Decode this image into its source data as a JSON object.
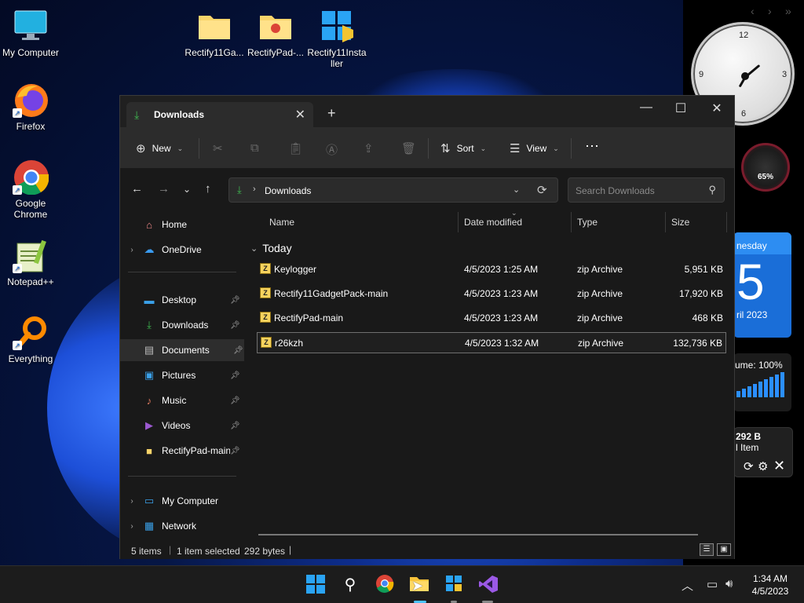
{
  "desktop": {
    "icons": [
      {
        "label": "My Computer"
      },
      {
        "label": "Firefox"
      },
      {
        "label": "Google Chrome"
      },
      {
        "label": "Notepad++"
      },
      {
        "label": "Everything"
      },
      {
        "label": "Rectify11Ga..."
      },
      {
        "label": "RectifyPad-..."
      },
      {
        "label": "Rectify11Insta ller"
      }
    ]
  },
  "widgets": {
    "clock_numbers": [
      "12",
      "3",
      "6",
      "9"
    ],
    "gauge_value": "65%",
    "calendar": {
      "day": "nesday",
      "date": "5",
      "month": "ril 2023"
    },
    "volume": {
      "label": "ume: 100%"
    },
    "recycle": {
      "size": "292 B",
      "items": "l Item"
    }
  },
  "explorer": {
    "tab": {
      "title": "Downloads"
    },
    "toolbar": {
      "new_label": "New",
      "sort_label": "Sort",
      "view_label": "View"
    },
    "address": {
      "location": "Downloads"
    },
    "search": {
      "placeholder": "Search Downloads"
    },
    "sidebar": {
      "items": [
        {
          "label": "Home",
          "icon": "home-icon"
        },
        {
          "label": "OneDrive",
          "icon": "cloud-icon"
        },
        {
          "label": "Desktop",
          "icon": "desktop-icon"
        },
        {
          "label": "Downloads",
          "icon": "download-icon"
        },
        {
          "label": "Documents",
          "icon": "document-icon"
        },
        {
          "label": "Pictures",
          "icon": "pictures-icon"
        },
        {
          "label": "Music",
          "icon": "music-icon"
        },
        {
          "label": "Videos",
          "icon": "video-icon"
        },
        {
          "label": "RectifyPad-main",
          "icon": "folder-icon"
        },
        {
          "label": "My Computer",
          "icon": "computer-icon"
        },
        {
          "label": "Network",
          "icon": "network-icon"
        }
      ]
    },
    "columns": {
      "name": "Name",
      "date": "Date modified",
      "type": "Type",
      "size": "Size"
    },
    "group": {
      "label": "Today"
    },
    "files": [
      {
        "name": "Keylogger",
        "date": "4/5/2023 1:25 AM",
        "type": "zip Archive",
        "size": "5,951 KB"
      },
      {
        "name": "Rectify11GadgetPack-main",
        "date": "4/5/2023 1:23 AM",
        "type": "zip Archive",
        "size": "17,920 KB"
      },
      {
        "name": "RectifyPad-main",
        "date": "4/5/2023 1:23 AM",
        "type": "zip Archive",
        "size": "468 KB"
      },
      {
        "name": "r26kzh",
        "date": "4/5/2023 1:32 AM",
        "type": "zip Archive",
        "size": "132,736 KB"
      }
    ],
    "status": {
      "items": "5 items",
      "selected": "1 item selected",
      "bytes": "292 bytes"
    }
  },
  "taskbar": {
    "time": "1:34 AM",
    "date": "4/5/2023"
  }
}
